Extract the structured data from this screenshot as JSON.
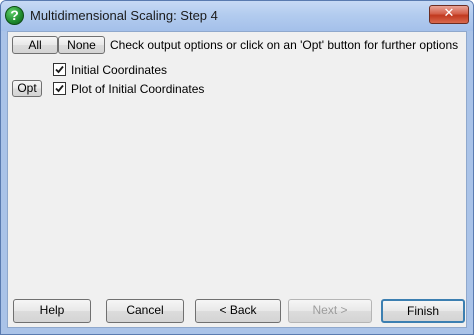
{
  "window": {
    "title": "Multidimensional Scaling: Step 4",
    "close_glyph": "✕",
    "help_glyph": "?"
  },
  "top_bar": {
    "all_label": "All",
    "none_label": "None",
    "instructions": "Check output options or click on an 'Opt' button for further options"
  },
  "options": [
    {
      "label": "Initial Coordinates",
      "checked": true,
      "has_opt": false
    },
    {
      "label": "Plot of Initial Coordinates",
      "checked": true,
      "has_opt": true,
      "opt_label": "Opt"
    }
  ],
  "buttons": {
    "help": "Help",
    "cancel": "Cancel",
    "back": "< Back",
    "next": "Next >",
    "finish": "Finish"
  },
  "colors": {
    "title_bar": "#aac3e8",
    "close_button": "#c1391f",
    "dialog_face": "#f0f0f0",
    "help_icon": "#1f8a2e"
  }
}
